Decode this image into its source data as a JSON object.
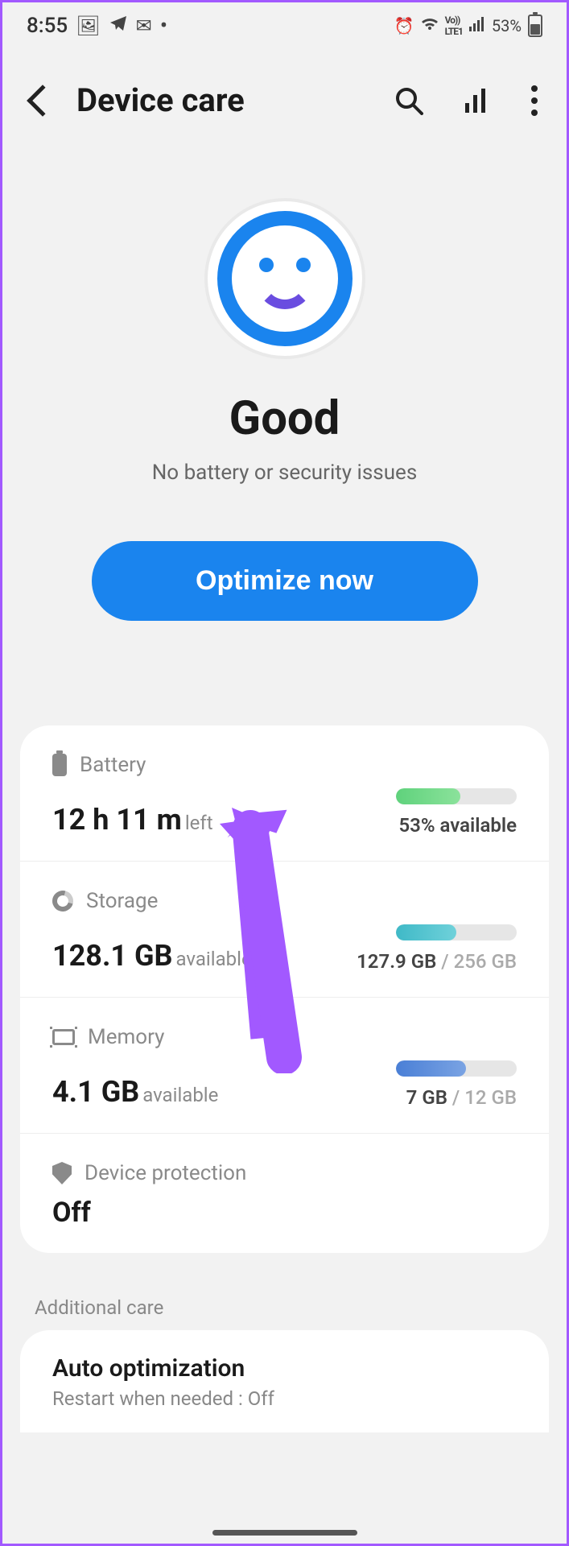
{
  "statusbar": {
    "time": "8:55",
    "battery_percent": "53%"
  },
  "header": {
    "title": "Device care"
  },
  "hero": {
    "status": "Good",
    "subtitle": "No battery or security issues",
    "button_label": "Optimize now"
  },
  "rows": {
    "battery": {
      "label": "Battery",
      "value": "12 h 11 m",
      "suffix": "left",
      "right": "53% available",
      "fill_pct": 53
    },
    "storage": {
      "label": "Storage",
      "value": "128.1 GB",
      "suffix": "available",
      "used": "127.9 GB",
      "total": "256 GB",
      "fill_pct": 50
    },
    "memory": {
      "label": "Memory",
      "value": "4.1 GB",
      "suffix": "available",
      "used": "7 GB",
      "total": "12 GB",
      "fill_pct": 58
    },
    "protection": {
      "label": "Device protection",
      "value": "Off"
    }
  },
  "additional": {
    "header": "Additional care",
    "auto_title": "Auto optimization",
    "auto_sub": "Restart when needed : Off"
  }
}
